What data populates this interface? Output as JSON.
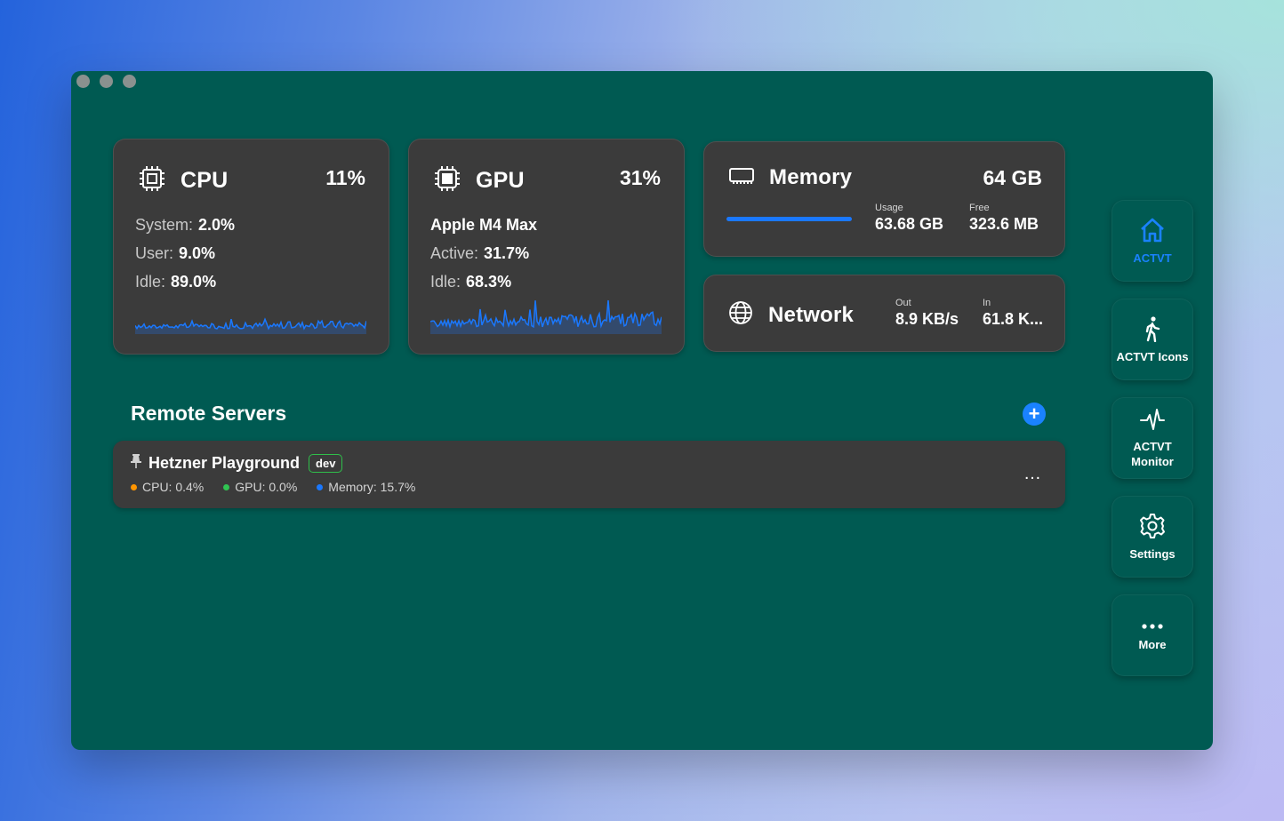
{
  "cpu": {
    "title": "CPU",
    "percent": "11%",
    "stats": [
      {
        "key": "System:",
        "value": "2.0%"
      },
      {
        "key": "User:",
        "value": "9.0%"
      },
      {
        "key": "Idle:",
        "value": "89.0%"
      }
    ],
    "icon": "cpu-chip-icon"
  },
  "gpu": {
    "title": "GPU",
    "percent": "31%",
    "name": "Apple M4 Max",
    "stats": [
      {
        "key": "Active:",
        "value": "31.7%"
      },
      {
        "key": "Idle:",
        "value": "68.3%"
      }
    ],
    "icon": "gpu-chip-icon"
  },
  "memory": {
    "title": "Memory",
    "total": "64 GB",
    "usage_label": "Usage",
    "usage_value": "63.68 GB",
    "free_label": "Free",
    "free_value": "323.6 MB",
    "icon": "memory-icon"
  },
  "network": {
    "title": "Network",
    "out_label": "Out",
    "out_value": "8.9 KB/s",
    "in_label": "In",
    "in_value": "61.8 K...",
    "icon": "globe-icon"
  },
  "remote_servers": {
    "title": "Remote Servers",
    "add_label": "+",
    "servers": [
      {
        "name": "Hetzner Playground",
        "tag": "dev",
        "cpu": "CPU: 0.4%",
        "gpu": "GPU: 0.0%",
        "memory": "Memory: 15.7%",
        "more": "…"
      }
    ]
  },
  "sidebar": {
    "items": [
      {
        "label": "ACTVT",
        "icon": "home-icon",
        "active": true
      },
      {
        "label": "ACTVT Icons",
        "icon": "walking-person-icon"
      },
      {
        "label": "ACTVT Monitor",
        "icon": "pulse-icon"
      },
      {
        "label": "Settings",
        "icon": "gear-icon"
      },
      {
        "label": "More",
        "icon": "more-dots-icon"
      }
    ]
  },
  "colors": {
    "window_bg": "#005a52",
    "card_bg": "#3b3b3b",
    "accent": "#1a82ff",
    "cpu_dot": "#ff9500",
    "gpu_dot": "#30c452",
    "memory_dot": "#1a78ff",
    "tag_border": "#2fbf4a"
  }
}
